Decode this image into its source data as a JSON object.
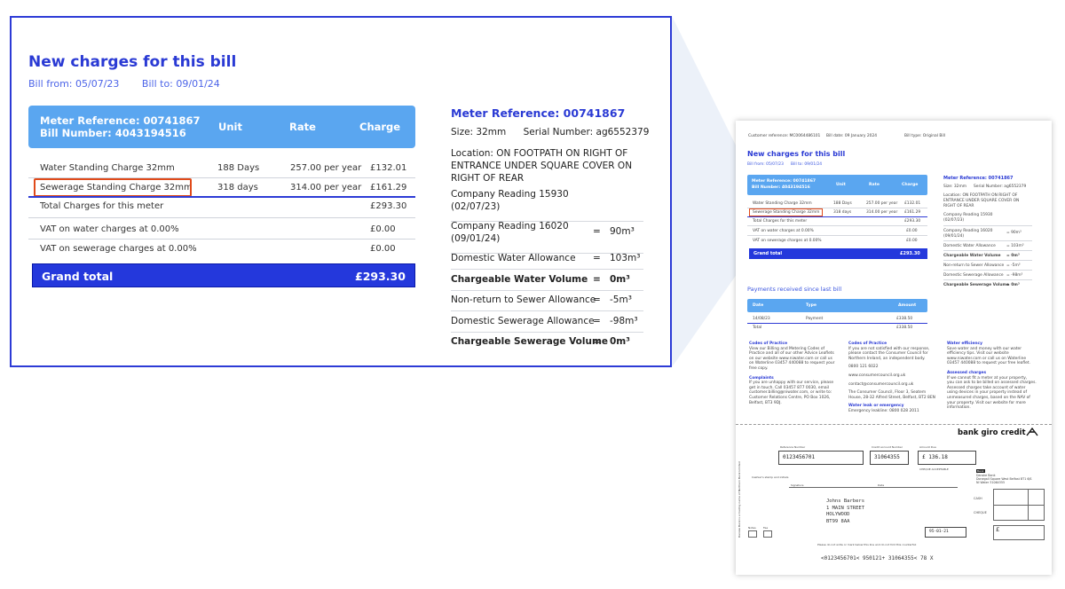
{
  "zoom": {
    "title": "New charges for this bill",
    "bill_from": "Bill from: 05/07/23",
    "bill_to": "Bill to: 09/01/24",
    "table_header": {
      "meter_reference": "Meter Reference: 00741867",
      "bill_number": "Bill Number: 4043194516",
      "unit": "Unit",
      "rate": "Rate",
      "charge": "Charge"
    },
    "rows": [
      {
        "desc": "Water Standing Charge 32mm",
        "unit": "188 Days",
        "rate": "257.00 per year",
        "charge": "£132.01"
      },
      {
        "desc": "Sewerage Standing Charge 32mm",
        "unit": "318 days",
        "rate": "314.00 per year",
        "charge": "£161.29"
      }
    ],
    "total_meter": {
      "label": "Total Charges for this meter",
      "value": "£293.30"
    },
    "vat_water": {
      "label": "VAT on water charges at 0.00%",
      "value": "£0.00"
    },
    "vat_sewerage": {
      "label": "VAT on sewerage charges at 0.00%",
      "value": "£0.00"
    },
    "grand_total": {
      "label": "Grand total",
      "value": "£293.30"
    },
    "meter": {
      "title": "Meter Reference: 00741867",
      "size": "Size: 32mm",
      "serial": "Serial Number: ag6552379",
      "location_1": "Location: ON FOOTPATH ON RIGHT OF",
      "location_2": "ENTRANCE UNDER SQUARE COVER ON",
      "location_3": "RIGHT OF REAR",
      "reading1_a": "Company Reading 15930",
      "reading1_b": "(02/07/23)",
      "reading2_a": "Company Reading 16020",
      "reading2_b": "(09/01/24)",
      "reading2_eq": "=",
      "reading2_val": "90m³",
      "items": [
        {
          "label": "Domestic Water Allowance",
          "eq": "=",
          "value": "103m³",
          "bold": false
        },
        {
          "label": "Chargeable Water Volume",
          "eq": "=",
          "value": "0m³",
          "bold": true
        },
        {
          "label": "Non-return to Sewer Allowance",
          "eq": "=",
          "value": "-5m³",
          "bold": false
        },
        {
          "label": "Domestic Sewerage Allowance",
          "eq": "=",
          "value": "-98m³",
          "bold": false
        },
        {
          "label": "Chargeable Sewerage Volume",
          "eq": "=",
          "value": "0m³",
          "bold": true
        }
      ]
    }
  },
  "page": {
    "customer_ref": "Customer reference: MC0064486101",
    "bill_date": "Bill date: 09 January 2024",
    "bill_type": "Bill type: Original Bill",
    "title": "New charges for this bill",
    "bill_from": "Bill from: 05/07/23",
    "bill_to": "Bill to: 09/01/24",
    "meter_ref": "Meter Reference: 00741867",
    "bill_number": "Bill Number: 4043194516",
    "unit": "Unit",
    "rate": "Rate",
    "charge": "Charge",
    "rows": [
      {
        "desc": "Water Standing Charge 32mm",
        "unit": "188 Days",
        "rate": "257.00 per year",
        "charge": "£132.01"
      },
      {
        "desc": "Sewerage Standing Charge 32mm",
        "unit": "318 days",
        "rate": "314.00 per year",
        "charge": "£161.29"
      }
    ],
    "total_meter": "Total Charges for this meter",
    "total_meter_val": "£293.30",
    "vat_water": "VAT on water charges at 0.00%",
    "vat_water_val": "£0.00",
    "vat_sewerage": "VAT on sewerage charges at 0.00%",
    "vat_sewerage_val": "£0.00",
    "grand_total": "Grand total",
    "grand_total_val": "£293.30",
    "meter_title": "Meter Reference: 00741867",
    "meter_size": "Size: 32mm",
    "meter_serial": "Serial Number: ag6552379",
    "meter_loc1": "Location: ON FOOTPATH ON RIGHT OF",
    "meter_loc2": "ENTRANCE UNDER SQUARE COVER ON",
    "meter_loc3": "RIGHT OF REAR",
    "meter_read1a": "Company Reading 15930",
    "meter_read1b": "(02/07/23)",
    "meter_read2a": "Company Reading 16020",
    "meter_read2b": "(09/01/24)",
    "meter_read2v": "= 90m³",
    "meter_items": [
      {
        "label": "Domestic Water Allowance",
        "value": "= 103m³"
      },
      {
        "label": "Chargeable Water Volume",
        "value": "= 0m³"
      },
      {
        "label": "Non-return to Sewer Allowance",
        "value": "= -5m³"
      },
      {
        "label": "Domestic Sewerage Allowance",
        "value": "= -98m³"
      },
      {
        "label": "Chargeable Sewerage Volume",
        "value": "= 0m³"
      }
    ],
    "payments_title": "Payments received since last bill",
    "pay_date": "Date",
    "pay_type": "Type",
    "pay_amount": "Amount",
    "pay_row_date": "14/08/23",
    "pay_row_type": "Payment",
    "pay_row_amount": "£338.50",
    "pay_total": "Total",
    "pay_total_amount": "£338.50",
    "codes_title": "Codes of Practice",
    "codes_text": [
      "View our Billing and Metering Codes of",
      "Practice and all of our other Advice Leaflets",
      "on our website www.niwater.com or call us",
      "on Waterline 03457 440088 to request your",
      "free copy."
    ],
    "complaints_title": "Complaints",
    "complaints_text": [
      "If you are unhappy with our service, please",
      "get in touch. Call 03457 877 0030, email",
      "customer.billing@niwater.com, or write to:",
      "Customer Relations Centre, PO Box 1026,",
      "Belfast, BT3 9DJ."
    ],
    "codes2_title": "Codes of Practice",
    "codes2_text": [
      "If you are not satisfied with our response,",
      "please contact the Consumer Council for",
      "Northern Ireland, an independent body."
    ],
    "cc_phone": "0800 121 6022",
    "cc_web": "www.consumercouncil.org.uk",
    "cc_email": "contact@consumercouncil.org.uk",
    "cc_addr": [
      "The Consumer Council, Floor 3, Seatem",
      "House, 28-32 Alfred Street, Belfast, BT2 8EN"
    ],
    "leak_title": "Water leak or emergency",
    "leak_text": "Emergency leakline: 0800 028 2011",
    "eff_title": "Water efficiency",
    "eff_text": [
      "Save water and money with our water",
      "efficiency tips. Visit our website",
      "www.niwater.com or call us on Waterline",
      "03457 440088 to request your free leaflet."
    ],
    "assessed_title": "Assessed charges",
    "assessed_text": [
      "If we cannot fit a meter at your property,",
      "you can ask to be billed on assessed charges.",
      "Assessed charges take account of water",
      "using devices in your property instead of",
      "unmeasured charges, based on the NAV of",
      "your property. Visit our website for more",
      "information."
    ],
    "giro_title": "bank giro credit",
    "ref_label": "Reference Number",
    "ref_value": "0123456701",
    "acct_label": "Credit account Number",
    "acct_value": "31064355",
    "amount_label": "Amount Due",
    "amount_value": "£  136.18",
    "cheque_label": "CHEQUE ACCEPTABLE",
    "bank_label": "Bank",
    "bank_lines": [
      "Danske Bank",
      "Donegall Square West Belfast BT1 6JS",
      "NI Water 31064355"
    ],
    "cashier_label": "Cashier's stamp and initials",
    "signature_label": "Signature",
    "date_label": "Date",
    "payer_lines": [
      "Johns Barbers",
      "1 MAIN STREET",
      "HOLYWOOD",
      "BT99 8AA"
    ],
    "cash_label": "CASH",
    "cheque_label2": "CHEQUE",
    "notes_label": "Notes",
    "fee_label": "Fee",
    "giro_date": "95-01-21",
    "giro_footer": "Please do not write or mark below this line and do not fold this counterfoil",
    "micr": "<0123456701<  950121+  31064355<  78  X",
    "side_text": "Danske Bank is a trading name of Northern Bank Limited"
  }
}
